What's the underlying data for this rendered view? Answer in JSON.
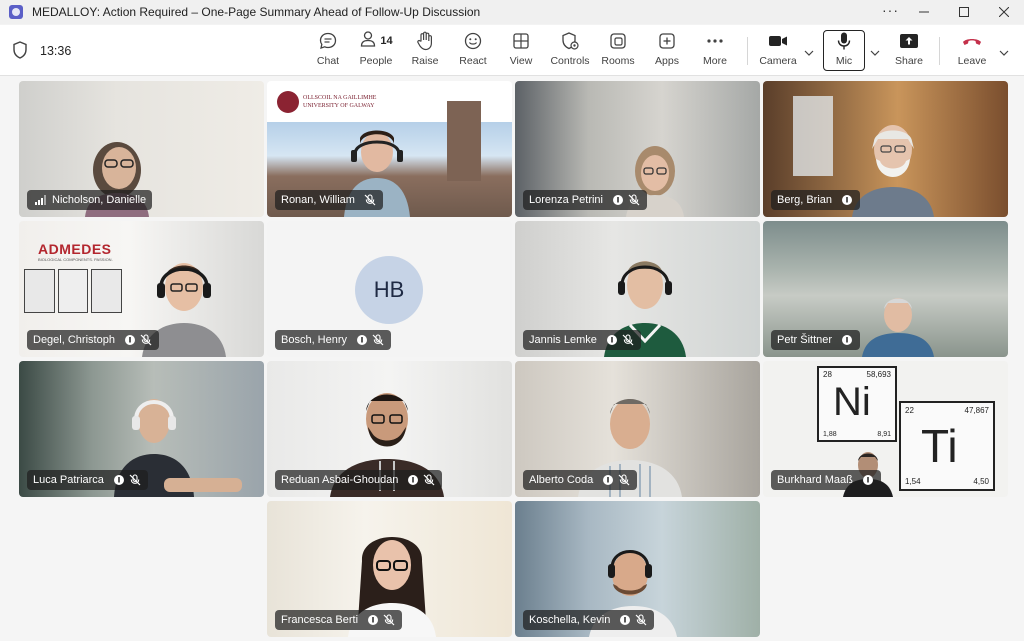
{
  "window": {
    "title": "MEDALLOY: Action Required – One-Page Summary Ahead of Follow-Up Discussion",
    "more": "···"
  },
  "toolbar": {
    "time": "13:36",
    "buttons": {
      "chat": "Chat",
      "people": "People",
      "people_count": "14",
      "raise": "Raise",
      "react": "React",
      "view": "View",
      "controls": "Controls",
      "rooms": "Rooms",
      "apps": "Apps",
      "more": "More",
      "camera": "Camera",
      "mic": "Mic",
      "share": "Share",
      "leave": "Leave"
    }
  },
  "participants": [
    {
      "name": "Nicholson, Danielle",
      "signal_icon": true
    },
    {
      "name": "Ronan, William",
      "background_text": [
        "OLLSCOIL NA GAILLIMHE",
        "UNIVERSITY OF GALWAY"
      ]
    },
    {
      "name": "Lorenza Petrini"
    },
    {
      "name": "Berg, Brian"
    },
    {
      "name": "Degel, Christoph",
      "background_text": [
        "ADMEDES",
        "BIOLOGICAL COMPONENTS. PASSION."
      ]
    },
    {
      "name": "Bosch, Henry",
      "initials": "HB"
    },
    {
      "name": "Jannis Lemke"
    },
    {
      "name": "Petr Šittner"
    },
    {
      "name": "Luca Patriarca"
    },
    {
      "name": "Reduan Asbai-Ghoudan"
    },
    {
      "name": "Alberto Coda"
    },
    {
      "name": "Burkhard Maaß",
      "background_text": {
        "ni_number": "28",
        "ni_mass": "58,693",
        "ni_symbol": "Ni",
        "ni_a": "1,88",
        "ni_b": "8,91",
        "ti_number": "22",
        "ti_mass": "47,867",
        "ti_symbol": "Ti",
        "ti_a": "1,54",
        "ti_b": "4,50"
      }
    },
    {
      "name": "Francesca Berti"
    },
    {
      "name": "Koschella, Kevin"
    }
  ],
  "colors": {
    "accent": "#5b5fc7",
    "leave_red": "#c4314b",
    "nameplate_bg": "#1e1e1e"
  }
}
